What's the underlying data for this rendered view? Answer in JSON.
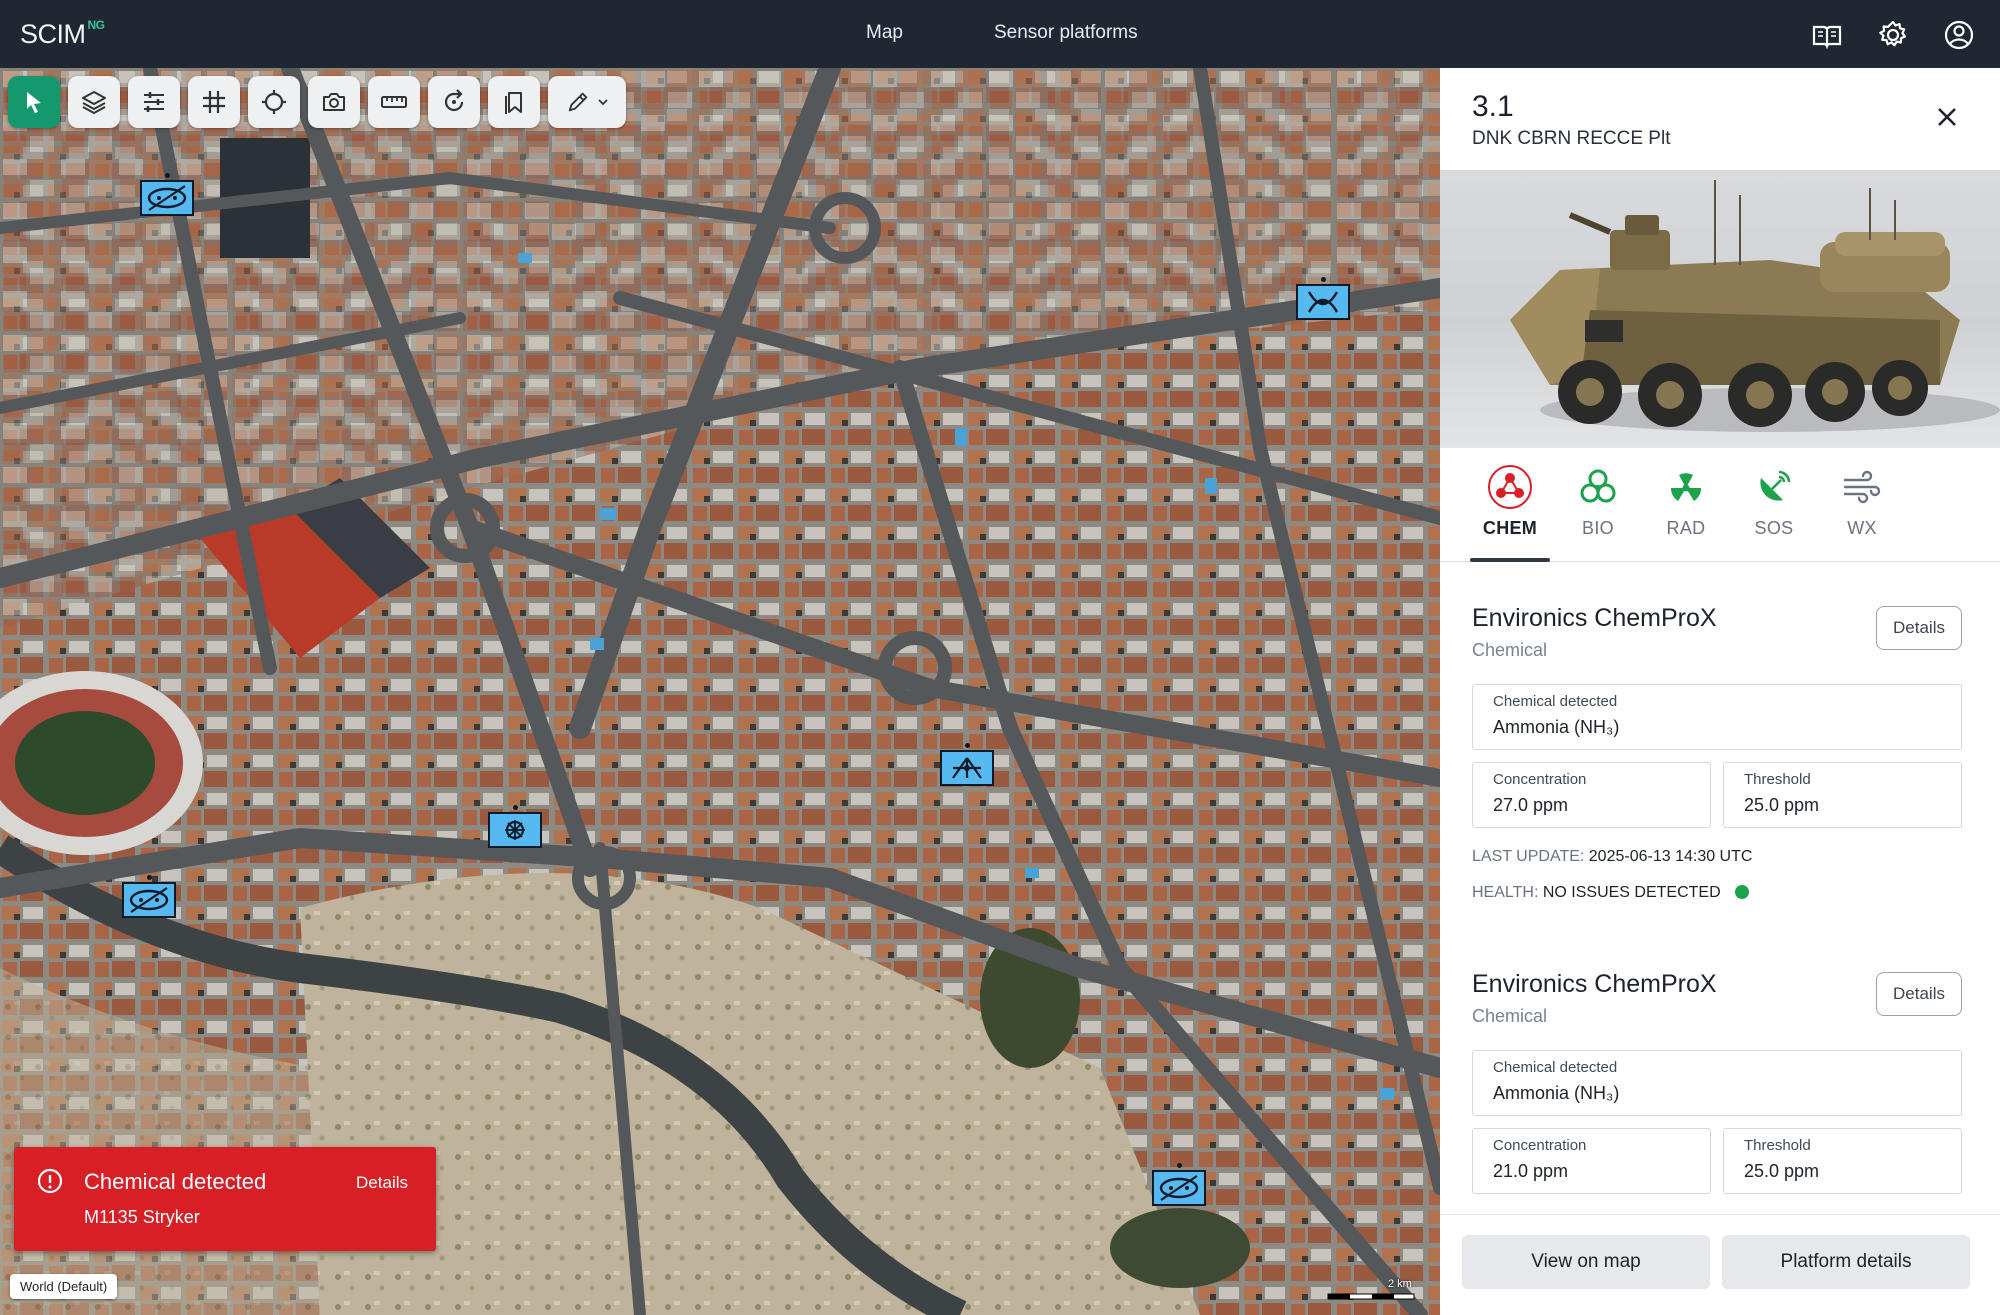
{
  "app": {
    "brand": "SCIM",
    "brand_sup": "NG"
  },
  "nav": {
    "map": "Map",
    "sensor_platforms": "Sensor platforms"
  },
  "header_icons": [
    "book-icon",
    "gear-icon",
    "user-icon"
  ],
  "toolbar": {
    "tools": [
      "select",
      "layers",
      "filters",
      "grid",
      "target",
      "camera",
      "ruler",
      "refresh",
      "bookmarks",
      "draw"
    ]
  },
  "alert": {
    "title": "Chemical detected",
    "subtitle": "M1135 Stryker",
    "link": "Details"
  },
  "map": {
    "layer_label": "World (Default)",
    "scale_label": "2 km"
  },
  "panel": {
    "title": "3.1",
    "subtitle": "DNK CBRN RECCE Plt",
    "tabs": [
      {
        "label": "CHEM",
        "icon": "chem-icon",
        "color": "#d81f26"
      },
      {
        "label": "BIO",
        "icon": "biohazard-icon",
        "color": "#1aa34a"
      },
      {
        "label": "RAD",
        "icon": "radiation-icon",
        "color": "#1aa34a"
      },
      {
        "label": "SOS",
        "icon": "sos-icon",
        "color": "#1aa34a"
      },
      {
        "label": "WX",
        "icon": "wind-icon",
        "color": "#6a7380"
      }
    ],
    "sensors": [
      {
        "name": "Environics ChemProX",
        "type": "Chemical",
        "details": "Details",
        "detected_label": "Chemical detected",
        "detected_value": "Ammonia (NH₃)",
        "concentration_label": "Concentration",
        "concentration_value": "27.0 ppm",
        "threshold_label": "Threshold",
        "threshold_value": "25.0 ppm",
        "last_update_label": "LAST UPDATE:",
        "last_update_value": "2025-06-13 14:30 UTC",
        "health_label": "HEALTH:",
        "health_value": "NO ISSUES DETECTED"
      },
      {
        "name": "Environics ChemProX",
        "type": "Chemical",
        "details": "Details",
        "detected_label": "Chemical detected",
        "detected_value": "Ammonia (NH₃)",
        "concentration_label": "Concentration",
        "concentration_value": "21.0 ppm",
        "threshold_label": "Threshold",
        "threshold_value": "25.0 ppm"
      }
    ],
    "buttons": {
      "view_on_map": "View on map",
      "platform_details": "Platform details"
    }
  },
  "colors": {
    "accent": "#16986e",
    "alert": "#d81f26",
    "healthy": "#1aa34a",
    "unit_fill": "#56b9f0"
  }
}
